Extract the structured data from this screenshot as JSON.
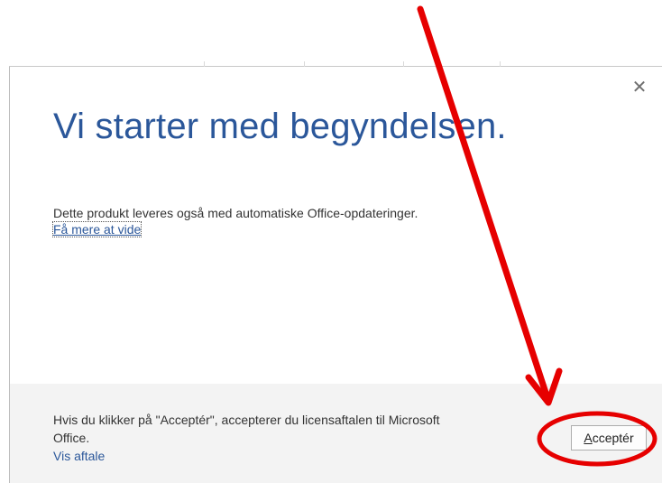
{
  "dialog": {
    "title": "Vi starter med begyndelsen.",
    "body_text": "Dette produkt leveres også med automatiske Office-opdateringer.",
    "learn_more_link": "Få mere at vide",
    "close_icon": "close-icon",
    "footer": {
      "text": "Hvis du klikker på \"Acceptér\", accepterer du licensaftalen til Microsoft Office.",
      "link": "Vis aftale",
      "accept_button_first_letter": "A",
      "accept_button_rest": "cceptér"
    }
  },
  "annotation": {
    "arrow_color": "#e60000",
    "highlight_target": "accept-button"
  },
  "colors": {
    "accent": "#2b579a",
    "footer_bg": "#f3f3f3"
  }
}
